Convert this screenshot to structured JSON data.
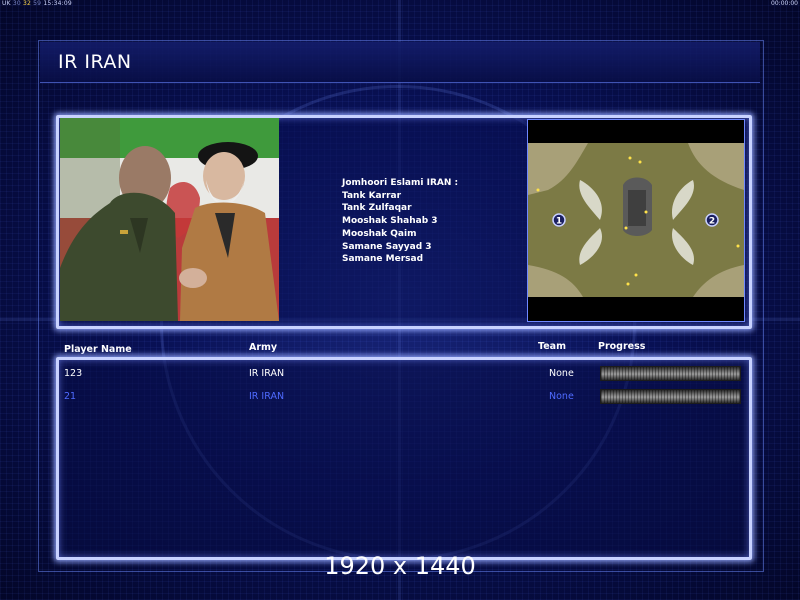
{
  "status_bar": {
    "left_text": "UK",
    "val1": "30",
    "val2": "32",
    "val3": "59",
    "clock": "15:34:09",
    "right_text": "00:00:00"
  },
  "header": {
    "title": "IR IRAN"
  },
  "army": {
    "heading": "Jomhoori Eslami IRAN :",
    "units": [
      "Tank Karrar",
      "Tank Zulfaqar",
      "Mooshak Shahab 3",
      "Mooshak Qaim",
      "Samane Sayyad 3",
      "Samane Mersad"
    ]
  },
  "minimap": {
    "start_positions": [
      "1",
      "2"
    ]
  },
  "table": {
    "columns": {
      "player_name": "Player Name",
      "army": "Army",
      "team": "Team",
      "progress": "Progress"
    },
    "rows": [
      {
        "player_name": "123",
        "army": "IR IRAN",
        "team": "None",
        "progress": 0
      },
      {
        "player_name": "21",
        "army": "IR IRAN",
        "team": "None",
        "progress": 0
      }
    ]
  },
  "resolution_label": "1920 x 1440"
}
